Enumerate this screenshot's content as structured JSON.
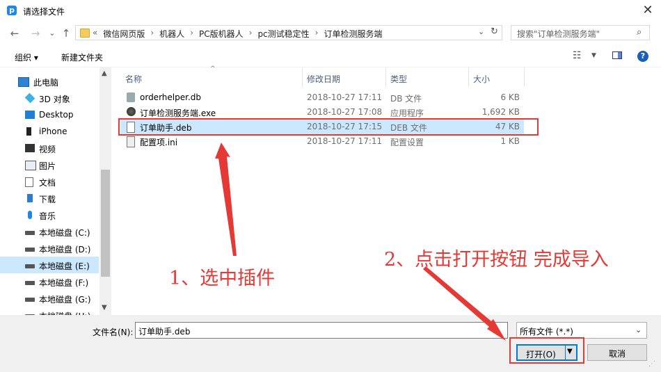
{
  "window": {
    "title": "请选择文件",
    "app_icon_letter": "p",
    "close_glyph": "✕"
  },
  "nav": {
    "back": "←",
    "forward": "→",
    "recent": "⌄",
    "up": "↑"
  },
  "address": {
    "crumbs": [
      "«",
      "微信网页版",
      "›",
      "机器人",
      "›",
      "PC版机器人",
      "›",
      "pc测试稳定性",
      "›",
      "订单检测服务端"
    ],
    "dropdown_glyph": "⌄",
    "refresh_glyph": "↻"
  },
  "search": {
    "placeholder": "搜索\"订单检测服务端\"",
    "icon_glyph": "⌕"
  },
  "toolbar": {
    "organize": "组织 ▾",
    "new_folder": "新建文件夹",
    "view_glyph": "☷",
    "view_arrow": "▼",
    "help": "?"
  },
  "sidebar": {
    "items": [
      {
        "label": "此电脑",
        "icon": "computer-icon"
      },
      {
        "label": "3D 对象",
        "icon": "cube-3d-icon"
      },
      {
        "label": "Desktop",
        "icon": "desktop-icon"
      },
      {
        "label": "iPhone",
        "icon": "phone-icon"
      },
      {
        "label": "视频",
        "icon": "video-icon"
      },
      {
        "label": "图片",
        "icon": "picture-icon"
      },
      {
        "label": "文档",
        "icon": "document-icon"
      },
      {
        "label": "下载",
        "icon": "download-icon"
      },
      {
        "label": "音乐",
        "icon": "music-icon"
      },
      {
        "label": "本地磁盘 (C:)",
        "icon": "drive-icon"
      },
      {
        "label": "本地磁盘 (D:)",
        "icon": "drive-icon"
      },
      {
        "label": "本地磁盘 (E:)",
        "icon": "drive-icon"
      },
      {
        "label": "本地磁盘 (F:)",
        "icon": "drive-icon"
      },
      {
        "label": "本地磁盘 (G:)",
        "icon": "drive-icon"
      },
      {
        "label": "本地磁盘 (H:)",
        "icon": "drive-icon"
      }
    ],
    "selected_index": 11,
    "scroll_up": "▲",
    "scroll_down": "▼"
  },
  "columns": {
    "name": "名称",
    "date": "修改日期",
    "type": "类型",
    "size": "大小",
    "sort_glyph": "^"
  },
  "files": [
    {
      "name": "orderhelper.db",
      "date": "2018-10-27 17:11",
      "type": "DB 文件",
      "size": "6 KB",
      "icon": "database-file-icon"
    },
    {
      "name": "订单检测服务端.exe",
      "date": "2018-10-27 17:08",
      "type": "应用程序",
      "size": "1,692 KB",
      "icon": "application-icon"
    },
    {
      "name": "订单助手.deb",
      "date": "2018-10-27 17:15",
      "type": "DEB 文件",
      "size": "47 KB",
      "icon": "blank-file-icon"
    },
    {
      "name": "配置项.ini",
      "date": "2018-10-27 17:11",
      "type": "配置设置",
      "size": "1 KB",
      "icon": "settings-file-icon"
    }
  ],
  "selected_file_index": 2,
  "footer": {
    "filename_label": "文件名(N):",
    "filename_value": "订单助手.deb",
    "filter_value": "所有文件 (*.*)",
    "filter_arrow": "⌄",
    "open_label": "打开(O)",
    "open_arrow": "▼",
    "cancel_label": "取消",
    "grip": "⋰"
  },
  "annotations": {
    "step1": "1、选中插件",
    "step2": "2、点击打开按钮 完成导入",
    "color": "#e53935"
  }
}
